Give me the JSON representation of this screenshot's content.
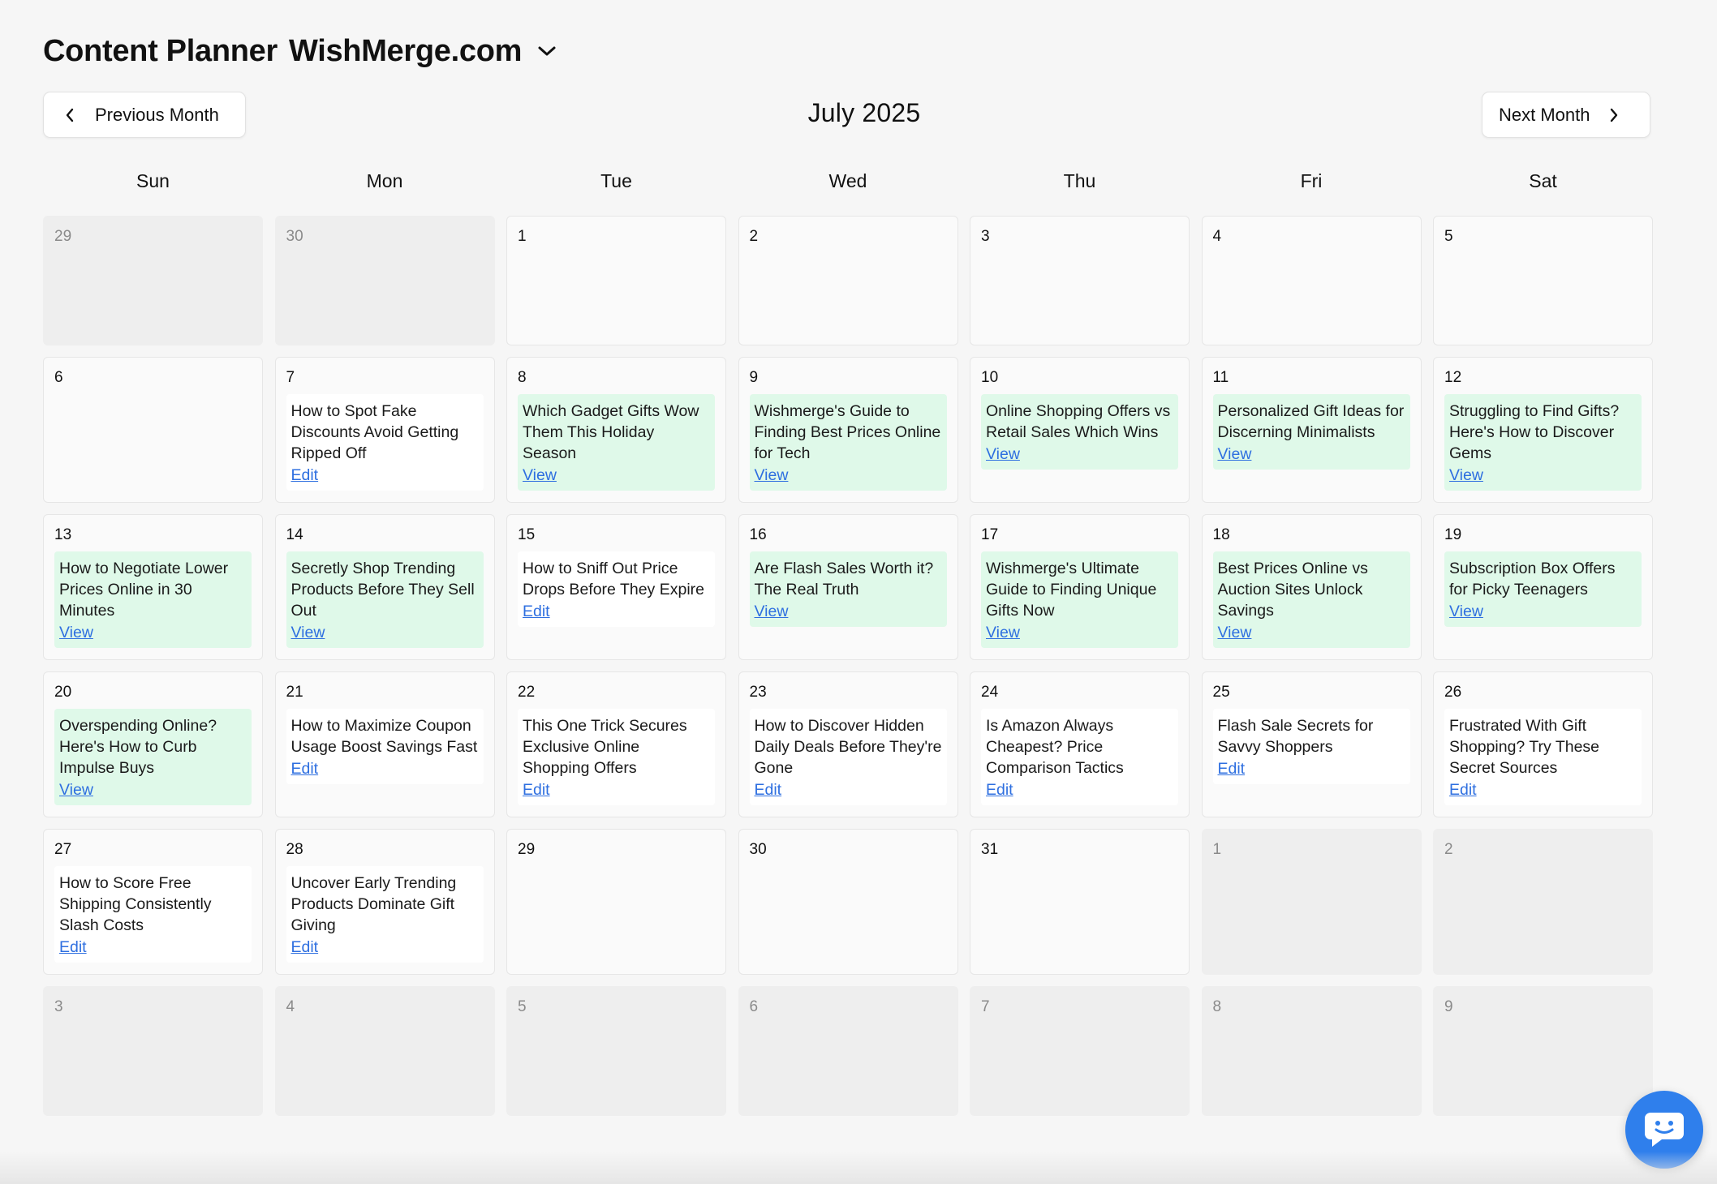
{
  "header": {
    "title": "Content Planner",
    "site": "WishMerge.com"
  },
  "nav": {
    "prev_label": "Previous Month",
    "next_label": "Next Month",
    "month_label": "July 2025"
  },
  "weekdays": [
    "Sun",
    "Mon",
    "Tue",
    "Wed",
    "Thu",
    "Fri",
    "Sat"
  ],
  "colors": {
    "published_bg": "#dff9e9",
    "link": "#2e6fe0",
    "chat": "#2f7fec"
  },
  "days": [
    {
      "day": "29",
      "other": true
    },
    {
      "day": "30",
      "other": true
    },
    {
      "day": "1"
    },
    {
      "day": "2"
    },
    {
      "day": "3"
    },
    {
      "day": "4"
    },
    {
      "day": "5"
    },
    {
      "day": "6"
    },
    {
      "day": "7",
      "post": {
        "title": "How to Spot Fake Discounts Avoid Getting Ripped Off",
        "action": "Edit",
        "status": "draft"
      }
    },
    {
      "day": "8",
      "post": {
        "title": "Which Gadget Gifts Wow Them This Holiday Season",
        "action": "View",
        "status": "published"
      }
    },
    {
      "day": "9",
      "post": {
        "title": "Wishmerge's Guide to Finding Best Prices Online for Tech",
        "action": "View",
        "status": "published"
      }
    },
    {
      "day": "10",
      "post": {
        "title": "Online Shopping Offers vs Retail Sales Which Wins",
        "action": "View",
        "status": "published"
      }
    },
    {
      "day": "11",
      "post": {
        "title": "Personalized Gift Ideas for Discerning Minimalists",
        "action": "View",
        "status": "published"
      }
    },
    {
      "day": "12",
      "post": {
        "title": "Struggling to Find Gifts? Here's How to Discover Gems",
        "action": "View",
        "status": "published"
      }
    },
    {
      "day": "13",
      "post": {
        "title": "How to Negotiate Lower Prices Online in 30 Minutes",
        "action": "View",
        "status": "published"
      }
    },
    {
      "day": "14",
      "post": {
        "title": "Secretly Shop Trending Products Before They Sell Out",
        "action": "View",
        "status": "published"
      }
    },
    {
      "day": "15",
      "post": {
        "title": "How to Sniff Out Price Drops Before They Expire",
        "action": "Edit",
        "status": "draft"
      }
    },
    {
      "day": "16",
      "post": {
        "title": "Are Flash Sales Worth it? The Real Truth",
        "action": "View",
        "status": "published"
      }
    },
    {
      "day": "17",
      "post": {
        "title": "Wishmerge's Ultimate Guide to Finding Unique Gifts Now",
        "action": "View",
        "status": "published"
      }
    },
    {
      "day": "18",
      "post": {
        "title": "Best Prices Online vs Auction Sites Unlock Savings",
        "action": "View",
        "status": "published"
      }
    },
    {
      "day": "19",
      "post": {
        "title": "Subscription Box Offers for Picky Teenagers",
        "action": "View",
        "status": "published"
      }
    },
    {
      "day": "20",
      "post": {
        "title": "Overspending Online? Here's How to Curb Impulse Buys",
        "action": "View",
        "status": "published"
      }
    },
    {
      "day": "21",
      "post": {
        "title": "How to Maximize Coupon Usage Boost Savings Fast",
        "action": "Edit",
        "status": "draft"
      }
    },
    {
      "day": "22",
      "post": {
        "title": "This One Trick Secures Exclusive Online Shopping Offers",
        "action": "Edit",
        "status": "draft"
      }
    },
    {
      "day": "23",
      "post": {
        "title": "How to Discover Hidden Daily Deals Before They're Gone",
        "action": "Edit",
        "status": "draft"
      }
    },
    {
      "day": "24",
      "post": {
        "title": "Is Amazon Always Cheapest? Price Comparison Tactics",
        "action": "Edit",
        "status": "draft"
      }
    },
    {
      "day": "25",
      "post": {
        "title": "Flash Sale Secrets for Savvy Shoppers",
        "action": "Edit",
        "status": "draft"
      }
    },
    {
      "day": "26",
      "post": {
        "title": "Frustrated With Gift Shopping? Try These Secret Sources",
        "action": "Edit",
        "status": "draft"
      }
    },
    {
      "day": "27",
      "post": {
        "title": "How to Score Free Shipping Consistently Slash Costs",
        "action": "Edit",
        "status": "draft"
      }
    },
    {
      "day": "28",
      "post": {
        "title": "Uncover Early Trending Products Dominate Gift Giving",
        "action": "Edit",
        "status": "draft"
      }
    },
    {
      "day": "29"
    },
    {
      "day": "30"
    },
    {
      "day": "31"
    },
    {
      "day": "1",
      "other": true
    },
    {
      "day": "2",
      "other": true
    },
    {
      "day": "3",
      "other": true
    },
    {
      "day": "4",
      "other": true
    },
    {
      "day": "5",
      "other": true
    },
    {
      "day": "6",
      "other": true
    },
    {
      "day": "7",
      "other": true
    },
    {
      "day": "8",
      "other": true
    },
    {
      "day": "9",
      "other": true
    }
  ]
}
